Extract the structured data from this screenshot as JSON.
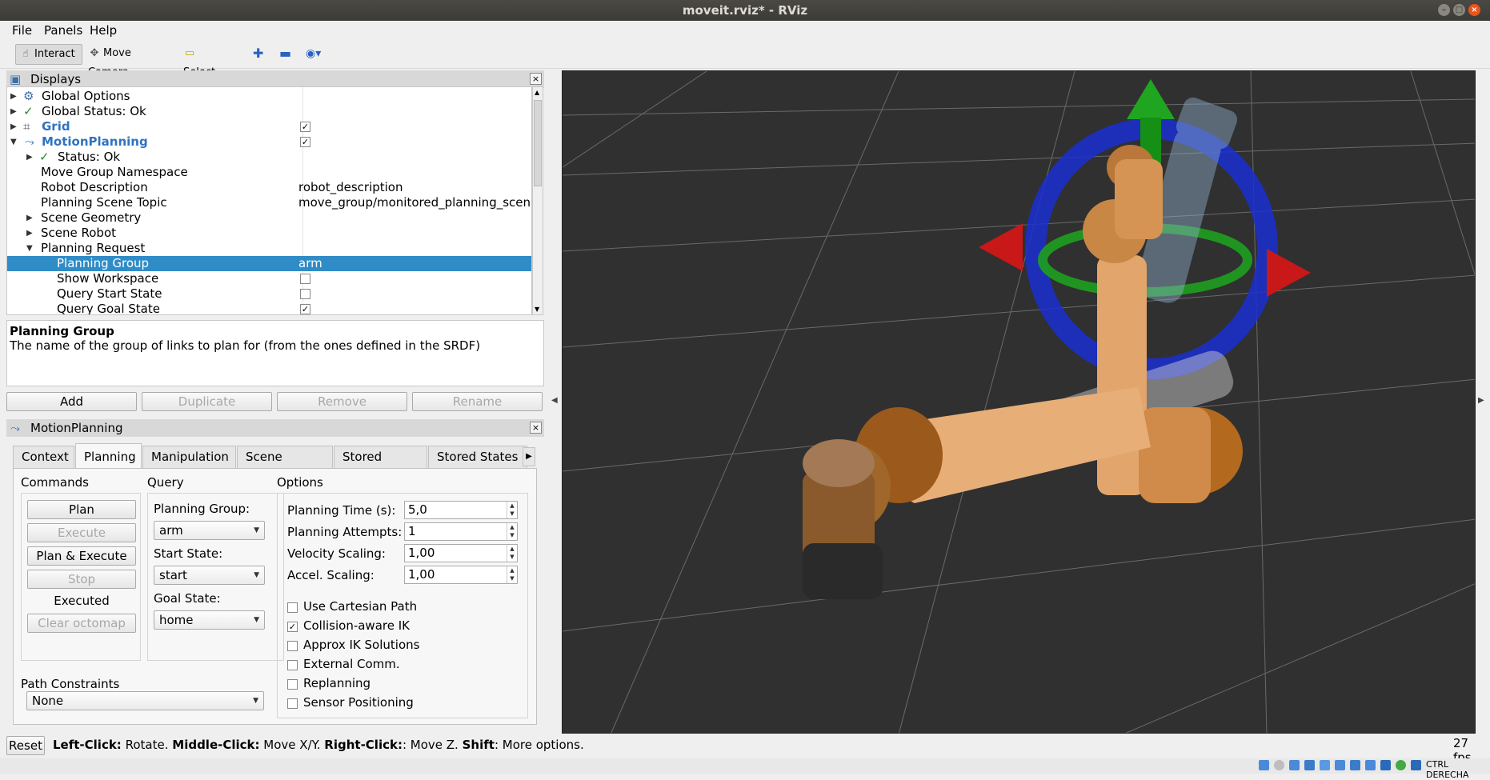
{
  "window": {
    "title": "moveit.rviz* - RViz"
  },
  "menubar": {
    "file": "File",
    "panels": "Panels",
    "help": "Help"
  },
  "toolbar": {
    "interact": "Interact",
    "move_camera": "Move Camera",
    "select": "Select"
  },
  "displays": {
    "title": "Displays",
    "rows": [
      {
        "label": "Global Options",
        "value": ""
      },
      {
        "label": "Global Status: Ok",
        "value": ""
      },
      {
        "label": "Grid",
        "value": ""
      },
      {
        "label": "MotionPlanning",
        "value": ""
      },
      {
        "label": "Status: Ok",
        "value": ""
      },
      {
        "label": "Move Group Namespace",
        "value": ""
      },
      {
        "label": "Robot Description",
        "value": "robot_description"
      },
      {
        "label": "Planning Scene Topic",
        "value": "move_group/monitored_planning_scene"
      },
      {
        "label": "Scene Geometry",
        "value": ""
      },
      {
        "label": "Scene Robot",
        "value": ""
      },
      {
        "label": "Planning Request",
        "value": ""
      },
      {
        "label": "Planning Group",
        "value": "arm"
      },
      {
        "label": "Show Workspace",
        "value": ""
      },
      {
        "label": "Query Start State",
        "value": ""
      },
      {
        "label": "Query Goal State",
        "value": ""
      }
    ],
    "checks": {
      "grid": true,
      "motion_planning": true,
      "show_workspace": false,
      "query_start_state": false,
      "query_goal_state": true
    },
    "description_title": "Planning Group",
    "description_text": "The name of the group of links to plan for (from the ones defined in the SRDF)",
    "buttons": {
      "add": "Add",
      "duplicate": "Duplicate",
      "remove": "Remove",
      "rename": "Rename"
    }
  },
  "motion_panel": {
    "title": "MotionPlanning",
    "tabs": [
      "Context",
      "Planning",
      "Manipulation",
      "Scene Objects",
      "Stored Scenes",
      "Stored States"
    ],
    "active_tab": "Planning",
    "commands": {
      "title": "Commands",
      "plan": "Plan",
      "execute": "Execute",
      "plan_execute": "Plan & Execute",
      "stop": "Stop",
      "status": "Executed",
      "clear_octomap": "Clear octomap"
    },
    "query": {
      "title": "Query",
      "planning_group_label": "Planning Group:",
      "planning_group": "arm",
      "start_state_label": "Start State:",
      "start_state": "start",
      "goal_state_label": "Goal State:",
      "goal_state": "home"
    },
    "options": {
      "title": "Options",
      "planning_time_label": "Planning Time (s):",
      "planning_time": "5,0",
      "planning_attempts_label": "Planning Attempts:",
      "planning_attempts": "1",
      "velocity_scaling_label": "Velocity Scaling:",
      "velocity_scaling": "1,00",
      "accel_scaling_label": "Accel. Scaling:",
      "accel_scaling": "1,00",
      "checkboxes": [
        {
          "label": "Use Cartesian Path",
          "checked": false
        },
        {
          "label": "Collision-aware IK",
          "checked": true
        },
        {
          "label": "Approx IK Solutions",
          "checked": false
        },
        {
          "label": "External Comm.",
          "checked": false
        },
        {
          "label": "Replanning",
          "checked": false
        },
        {
          "label": "Sensor Positioning",
          "checked": false
        }
      ]
    },
    "path_constraints": {
      "label": "Path Constraints",
      "value": "None"
    }
  },
  "statusbar": {
    "reset": "Reset",
    "left_click": "Left-Click:",
    "left_click_desc": "Rotate.",
    "middle_click": "Middle-Click:",
    "middle_click_desc": "Move X/Y.",
    "right_click": "Right-Click:",
    "right_click_desc": ": Move Z.",
    "shift": "Shift",
    "shift_desc": ": More options.",
    "fps": "27 fps"
  },
  "taskbar": {
    "host_key": "CTRL DERECHA"
  },
  "colors": {
    "selection": "#308cc6",
    "viewport_bg": "#303030",
    "robot_orange": "#d08a4a",
    "ring_blue": "#1a2fd0",
    "ring_green": "#1fa01f",
    "arrow_red": "#c81818"
  }
}
